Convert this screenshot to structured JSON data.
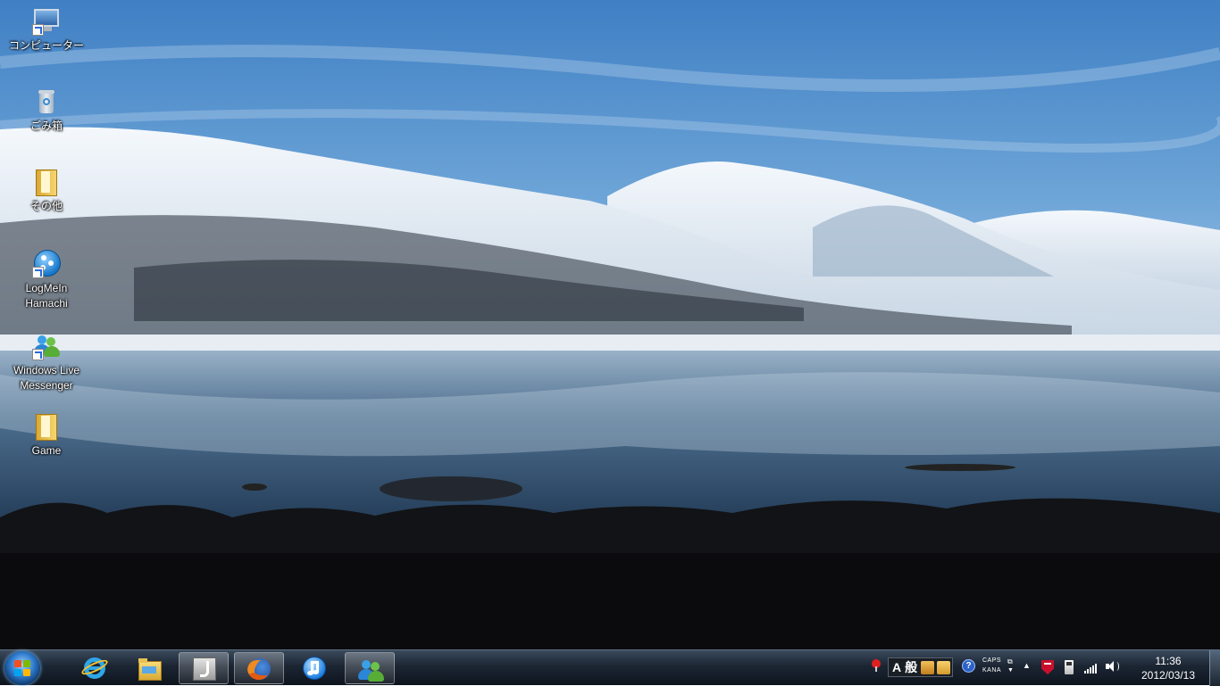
{
  "desktop": {
    "icons": [
      {
        "label": "コンピューター",
        "icon": "computer-icon"
      },
      {
        "label": "ごみ箱",
        "icon": "recycle-bin-icon"
      },
      {
        "label": "その他",
        "icon": "folder-icon"
      },
      {
        "label": "LogMeIn Hamachi",
        "icon": "hamachi-icon"
      },
      {
        "label": "Windows Live Messenger",
        "icon": "messenger-icon"
      },
      {
        "label": "Game",
        "icon": "folder-icon"
      }
    ]
  },
  "taskbar": {
    "pinned": [
      "start-orb-icon",
      "internet-explorer-icon",
      "file-explorer-icon",
      "java-app-icon",
      "firefox-icon",
      "itunes-icon",
      "messenger-icon"
    ],
    "ime": {
      "mode_a": "A",
      "mode_kanji": "般"
    },
    "caps_label": "CAPS",
    "kana_label": "KANA",
    "clock": {
      "time": "11:36",
      "date": "2012/03/13"
    }
  },
  "colors": {
    "accent": "#2b77c9",
    "taskbar": "#1c2633"
  }
}
